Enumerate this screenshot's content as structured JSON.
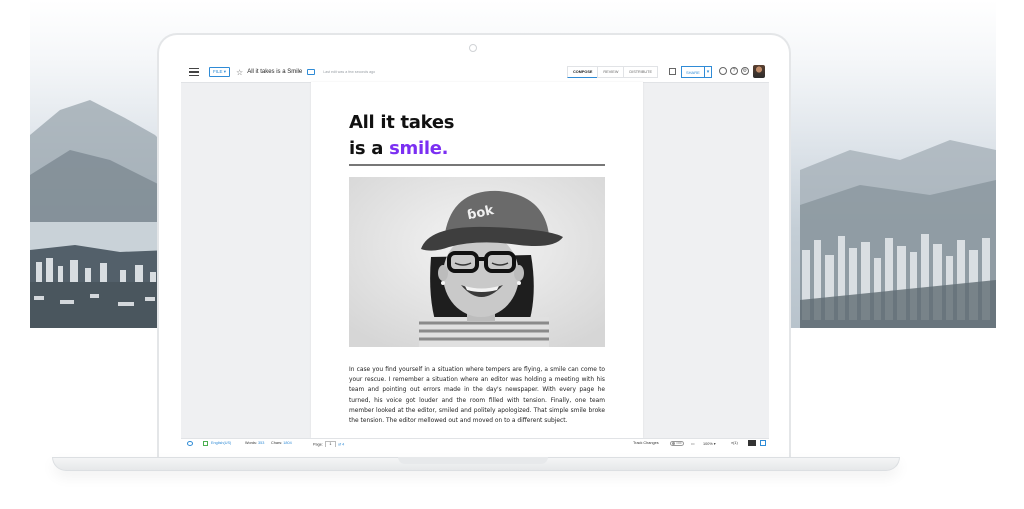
{
  "editor": {
    "file_menu": "FILE ▾",
    "doc_title": "All it takes is a Smile",
    "last_edit": "Last edit was a few seconds ago",
    "tabs": [
      {
        "label": "COMPOSE",
        "active": true
      },
      {
        "label": "REVIEW",
        "active": false
      },
      {
        "label": "DISTRIBUTE",
        "active": false
      }
    ],
    "share_label": "SHARE",
    "icons": [
      "menu-icon",
      "star-icon",
      "folder-icon",
      "sidebar-icon",
      "search-user-icon",
      "help-icon",
      "gear-icon"
    ]
  },
  "document": {
    "headline_line1": "All it takes",
    "headline_line2_prefix": "is a ",
    "headline_accent": "smile.",
    "accent_color": "#7b2ff2",
    "body": "In case you find yourself in a situation where tempers are flying, a smile can come to your rescue. I remember a situation where an editor was holding a meeting with his team and pointing out errors made in the day's newspaper. With every page he turned, his voice got louder and the room filled with tension. Finally, one team member looked at the editor, smiled and politely apologized. That simple smile broke the tension. The editor mellowed out and moved on to a different subject."
  },
  "statusbar": {
    "language": "English(US)",
    "words_label": "Words:",
    "words_value": "353",
    "chars_label": "Chars:",
    "chars_value": "1804",
    "page_label": "Page:",
    "page_current": "1",
    "page_total": "of 4",
    "track_changes_label": "Track Changes",
    "track_toggle": "OFF",
    "zoom": "100%",
    "comments_count": "(1)"
  }
}
